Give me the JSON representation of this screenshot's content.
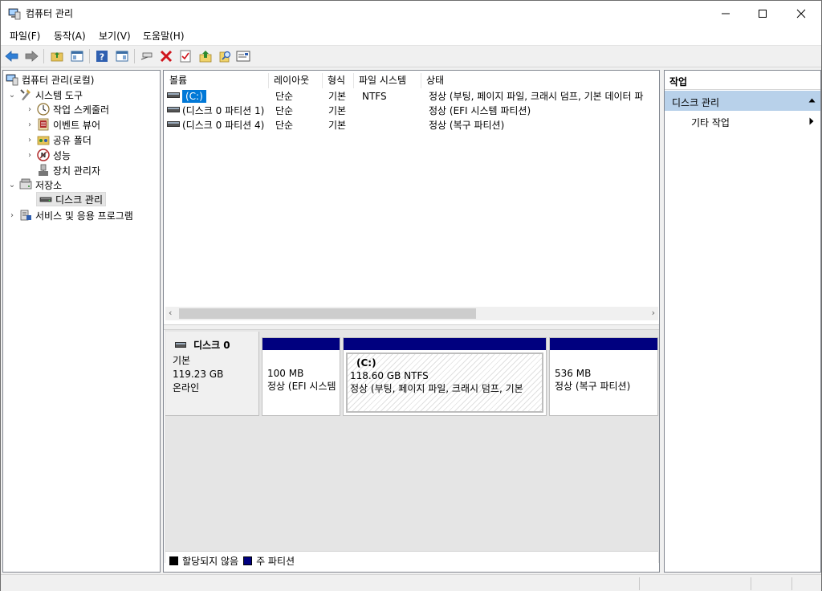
{
  "window": {
    "title": "컴퓨터 관리"
  },
  "menu": [
    "파일(F)",
    "동작(A)",
    "보기(V)",
    "도움말(H)"
  ],
  "tree": {
    "root": "컴퓨터 관리(로컬)",
    "system_tools": "시스템 도구",
    "task_scheduler": "작업 스케줄러",
    "event_viewer": "이벤트 뷰어",
    "shared_folders": "공유 폴더",
    "performance": "성능",
    "device_manager": "장치 관리자",
    "storage": "저장소",
    "disk_management": "디스크 관리",
    "services_apps": "서비스 및 응용 프로그램"
  },
  "volume_list": {
    "columns": [
      "볼륨",
      "레이아웃",
      "형식",
      "파일 시스템",
      "상태"
    ],
    "rows": [
      {
        "volume": "(C:)",
        "layout": "단순",
        "type": "기본",
        "fs": "NTFS",
        "status": "정상 (부팅, 페이지 파일, 크래시 덤프, 기본 데이터 파"
      },
      {
        "volume": "(디스크 0 파티션 1)",
        "layout": "단순",
        "type": "기본",
        "fs": "",
        "status": "정상 (EFI 시스템 파티션)"
      },
      {
        "volume": "(디스크 0 파티션 4)",
        "layout": "단순",
        "type": "기본",
        "fs": "",
        "status": "정상 (복구 파티션)"
      }
    ]
  },
  "disk": {
    "name": "디스크 0",
    "type": "기본",
    "size": "119.23 GB",
    "state": "온라인",
    "partitions": [
      {
        "title": "",
        "size": "100 MB",
        "status": "정상 (EFI 시스템"
      },
      {
        "title": "(C:)",
        "size": "118.60 GB NTFS",
        "status": "정상 (부팅, 페이지 파일, 크래시 덤프, 기본 "
      },
      {
        "title": "",
        "size": "536 MB",
        "status": "정상 (복구 파티션)"
      }
    ]
  },
  "legend": {
    "unallocated": "할당되지 않음",
    "primary": "주 파티션"
  },
  "actions": {
    "header": "작업",
    "section": "디스크 관리",
    "more": "기타 작업"
  },
  "colors": {
    "partition_bar": "#00007f",
    "selection": "#b8d1ea",
    "volume_highlight": "#0078d7"
  }
}
